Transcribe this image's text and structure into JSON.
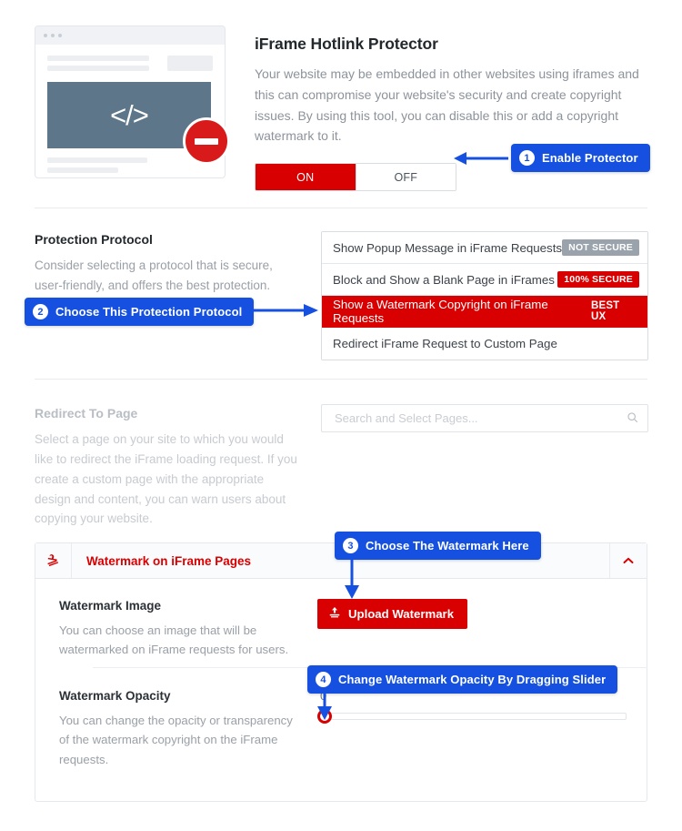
{
  "hero": {
    "title": "iFrame Hotlink Protector",
    "description": "Your website may be embedded in other websites using iframes and this can compromise your website's security and create copyright issues. By using this tool, you can disable this or add a copyright watermark to it.",
    "toggle": {
      "on_label": "ON",
      "off_label": "OFF",
      "selected": "ON"
    },
    "mock_icon": "code-brackets-icon",
    "mock_badge_icon": "no-entry-icon"
  },
  "protocol": {
    "label": "Protection Protocol",
    "description": "Consider selecting a protocol that is secure, user-friendly, and offers the best protection.",
    "options": [
      {
        "label": "Show Popup Message in iFrame Requests",
        "badge": "NOT SECURE",
        "badge_style": "gray",
        "selected": false
      },
      {
        "label": "Block and Show a Blank Page in iFrames",
        "badge": "100% SECURE",
        "badge_style": "red",
        "selected": false
      },
      {
        "label": "Show a Watermark Copyright on iFrame Requests",
        "badge": "BEST UX",
        "badge_style": "plain",
        "selected": true
      },
      {
        "label": "Redirect iFrame Request to Custom Page",
        "badge": "",
        "badge_style": "none",
        "selected": false
      }
    ]
  },
  "redirect": {
    "label": "Redirect To Page",
    "description": "Select a page on your site to which you would like to redirect the iFrame loading request. If you create a custom page with the appropriate design and content, you can warn users about copying your website.",
    "search_placeholder": "Search and Select Pages...",
    "search_value": "",
    "search_icon": "search-icon"
  },
  "watermark_panel": {
    "icon": "stamp-icon",
    "title": "Watermark on iFrame Pages",
    "collapse_icon": "chevron-up-icon",
    "image_section": {
      "label": "Watermark Image",
      "description": "You can choose an image that will be watermarked on iFrame requests for users.",
      "upload_label": "Upload Watermark",
      "upload_icon": "upload-icon"
    },
    "opacity_section": {
      "label": "Watermark Opacity",
      "description": "You can change the opacity or transparency of the watermark copyright on the iFrame requests.",
      "value": "0",
      "min": 0,
      "max": 100
    }
  },
  "callouts": [
    {
      "number": "1",
      "text": "Enable Protector"
    },
    {
      "number": "2",
      "text": "Choose This Protection Protocol"
    },
    {
      "number": "3",
      "text": "Choose The Watermark Here"
    },
    {
      "number": "4",
      "text": "Change Watermark Opacity By Dragging Slider"
    }
  ],
  "colors": {
    "brand_red": "#d80000",
    "callout_blue": "#1550e0",
    "badge_gray": "#9aa3ac",
    "mock_screen": "#5d7689"
  }
}
